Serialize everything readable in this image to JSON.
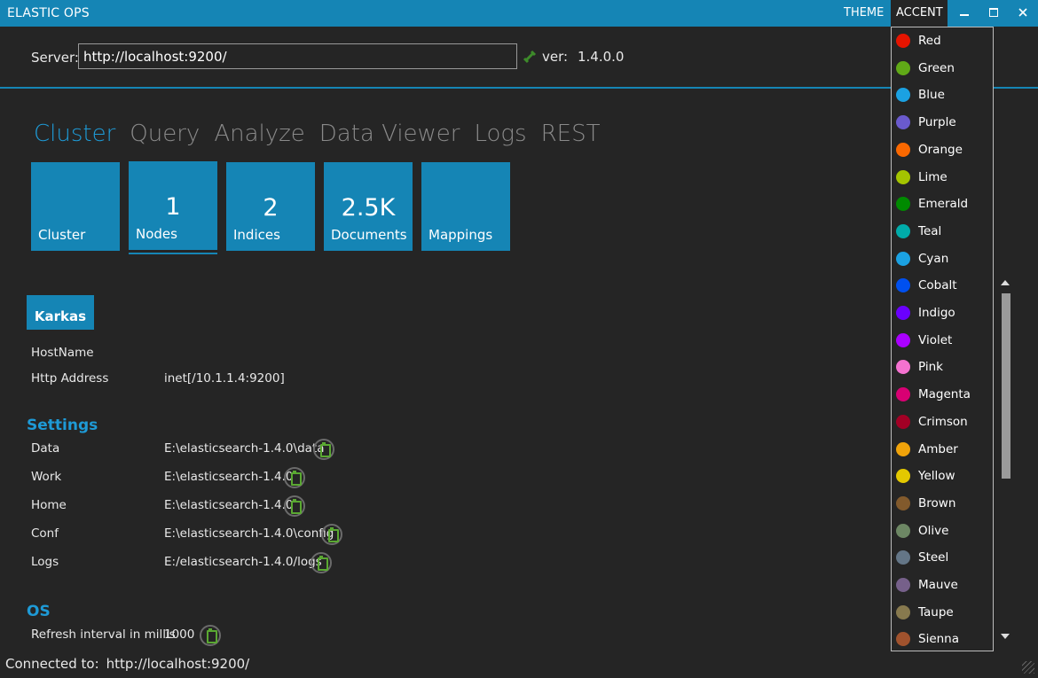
{
  "titlebar": {
    "app_title": "ELASTIC OPS",
    "theme_label": "THEME",
    "accent_label": "ACCENT",
    "minimize_icon": "minimize-icon",
    "maximize_icon": "maximize-icon",
    "close_icon": "close-icon"
  },
  "server": {
    "label": "Server:",
    "url": "http://localhost:9200/",
    "ver_label": "ver:",
    "version": "1.4.0.0"
  },
  "tabs": [
    {
      "label": "Cluster",
      "active": true
    },
    {
      "label": "Query"
    },
    {
      "label": "Analyze"
    },
    {
      "label": "Data Viewer"
    },
    {
      "label": "Logs"
    },
    {
      "label": "REST"
    }
  ],
  "tiles": [
    {
      "num": "",
      "label": "Cluster"
    },
    {
      "num": "1",
      "label": "Nodes"
    },
    {
      "num": "2",
      "label": "Indices"
    },
    {
      "num": "2.5K",
      "label": "Documents"
    },
    {
      "num": "",
      "label": "Mappings"
    }
  ],
  "node": {
    "name": "Karkas",
    "hostname_label": "HostName",
    "hostname_value": "",
    "http_label": "Http Address",
    "http_value": "inet[/10.1.1.4:9200]"
  },
  "settings": {
    "heading": "Settings",
    "rows": [
      {
        "label": "Data",
        "value": "E:\\elasticsearch-1.4.0\\data"
      },
      {
        "label": "Work",
        "value": "E:\\elasticsearch-1.4.0"
      },
      {
        "label": "Home",
        "value": "E:\\elasticsearch-1.4.0"
      },
      {
        "label": "Conf",
        "value": "E:\\elasticsearch-1.4.0\\config"
      },
      {
        "label": "Logs",
        "value": "E:/elasticsearch-1.4.0/logs"
      }
    ]
  },
  "os": {
    "heading": "OS",
    "refresh_label": "Refresh interval in millis",
    "refresh_value": "1000"
  },
  "status": {
    "connected_label": "Connected to:",
    "connected_url": "http://localhost:9200/"
  },
  "accent_colors": [
    {
      "name": "Red",
      "color": "#e51400"
    },
    {
      "name": "Green",
      "color": "#60a917"
    },
    {
      "name": "Blue",
      "color": "#1ba1e2"
    },
    {
      "name": "Purple",
      "color": "#6a5acd"
    },
    {
      "name": "Orange",
      "color": "#fa6800"
    },
    {
      "name": "Lime",
      "color": "#a4c400"
    },
    {
      "name": "Emerald",
      "color": "#008a00"
    },
    {
      "name": "Teal",
      "color": "#00aba9"
    },
    {
      "name": "Cyan",
      "color": "#1ba1e2"
    },
    {
      "name": "Cobalt",
      "color": "#0050ef"
    },
    {
      "name": "Indigo",
      "color": "#6a00ff"
    },
    {
      "name": "Violet",
      "color": "#aa00ff"
    },
    {
      "name": "Pink",
      "color": "#f472d0"
    },
    {
      "name": "Magenta",
      "color": "#d80073"
    },
    {
      "name": "Crimson",
      "color": "#a20025"
    },
    {
      "name": "Amber",
      "color": "#f0a30a"
    },
    {
      "name": "Yellow",
      "color": "#e3c800"
    },
    {
      "name": "Brown",
      "color": "#825a2c"
    },
    {
      "name": "Olive",
      "color": "#6d8764"
    },
    {
      "name": "Steel",
      "color": "#647687"
    },
    {
      "name": "Mauve",
      "color": "#76608a"
    },
    {
      "name": "Taupe",
      "color": "#87794e"
    },
    {
      "name": "Sienna",
      "color": "#a0522d"
    }
  ],
  "colors": {
    "accent": "#1585b5",
    "accent_text": "#1e9ad6",
    "background": "#252525"
  }
}
